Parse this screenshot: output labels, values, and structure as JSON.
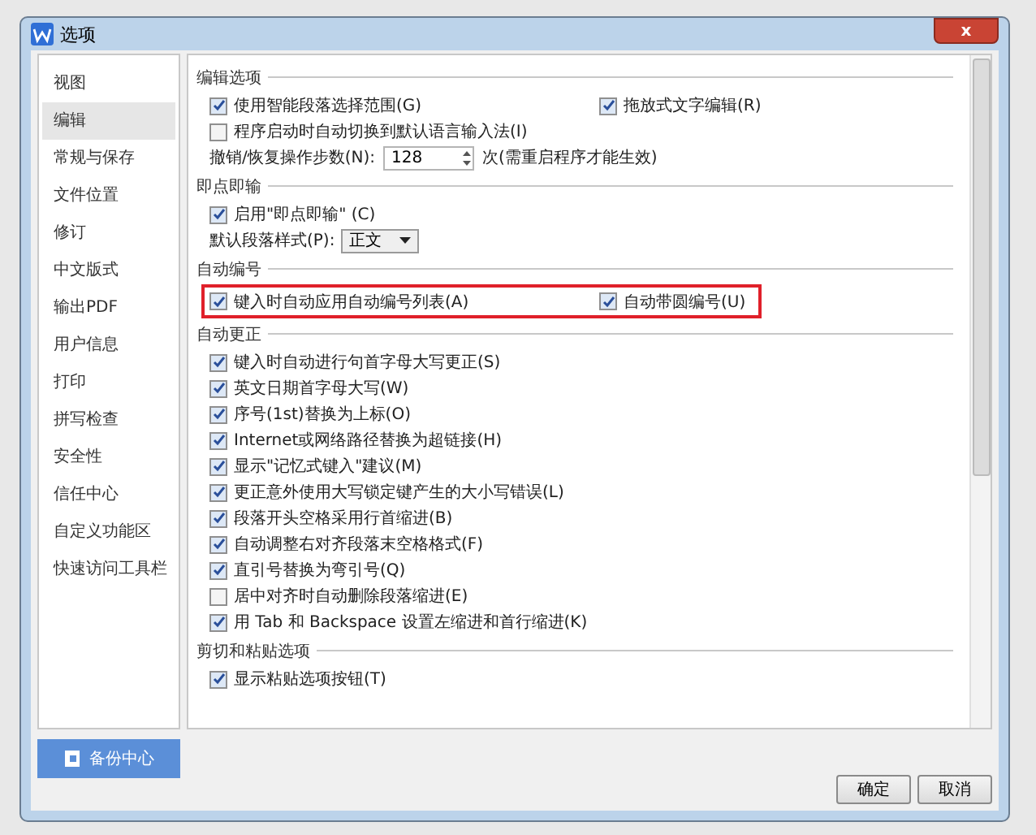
{
  "window": {
    "title": "选项",
    "close": "x"
  },
  "sidebar": {
    "items": [
      {
        "label": "视图",
        "selected": false
      },
      {
        "label": "编辑",
        "selected": true
      },
      {
        "label": "常规与保存",
        "selected": false
      },
      {
        "label": "文件位置",
        "selected": false
      },
      {
        "label": "修订",
        "selected": false
      },
      {
        "label": "中文版式",
        "selected": false
      },
      {
        "label": "输出PDF",
        "selected": false
      },
      {
        "label": "用户信息",
        "selected": false
      },
      {
        "label": "打印",
        "selected": false
      },
      {
        "label": "拼写检查",
        "selected": false
      },
      {
        "label": "安全性",
        "selected": false
      },
      {
        "label": "信任中心",
        "selected": false
      },
      {
        "label": "自定义功能区",
        "selected": false
      },
      {
        "label": "快速访问工具栏",
        "selected": false
      }
    ]
  },
  "backup_button": "备份中心",
  "sections": [
    {
      "title": "编辑选项",
      "highlighted": false,
      "rows": [
        {
          "kind": "pair",
          "items": [
            {
              "label": "使用智能段落选择范围(G)",
              "checked": true
            },
            {
              "label": "拖放式文字编辑(R)",
              "checked": true
            }
          ]
        },
        {
          "kind": "checkbox",
          "label": "程序启动时自动切换到默认语言输入法(I)",
          "checked": false
        },
        {
          "kind": "spinner",
          "label": "撤销/恢复操作步数(N):",
          "value": "128",
          "note": "次(需重启程序才能生效)"
        }
      ]
    },
    {
      "title": "即点即输",
      "highlighted": false,
      "rows": [
        {
          "kind": "checkbox",
          "label": "启用\"即点即输\" (C)",
          "checked": true
        },
        {
          "kind": "select",
          "label": "默认段落样式(P):",
          "value": "正文"
        }
      ]
    },
    {
      "title": "自动编号",
      "highlighted": true,
      "rows": [
        {
          "kind": "pair",
          "items": [
            {
              "label": "键入时自动应用自动编号列表(A)",
              "checked": true
            },
            {
              "label": "自动带圆编号(U)",
              "checked": true
            }
          ]
        }
      ]
    },
    {
      "title": "自动更正",
      "highlighted": false,
      "rows": [
        {
          "kind": "checkbox",
          "label": "键入时自动进行句首字母大写更正(S)",
          "checked": true
        },
        {
          "kind": "checkbox",
          "label": "英文日期首字母大写(W)",
          "checked": true
        },
        {
          "kind": "checkbox",
          "label": "序号(1st)替换为上标(O)",
          "checked": true
        },
        {
          "kind": "checkbox",
          "label": "Internet或网络路径替换为超链接(H)",
          "checked": true
        },
        {
          "kind": "checkbox",
          "label": "显示\"记忆式键入\"建议(M)",
          "checked": true
        },
        {
          "kind": "checkbox",
          "label": "更正意外使用大写锁定键产生的大小写错误(L)",
          "checked": true
        },
        {
          "kind": "checkbox",
          "label": "段落开头空格采用行首缩进(B)",
          "checked": true
        },
        {
          "kind": "checkbox",
          "label": "自动调整右对齐段落末空格格式(F)",
          "checked": true
        },
        {
          "kind": "checkbox",
          "label": "直引号替换为弯引号(Q)",
          "checked": true
        },
        {
          "kind": "checkbox",
          "label": "居中对齐时自动删除段落缩进(E)",
          "checked": false
        },
        {
          "kind": "checkbox",
          "label": "用 Tab 和 Backspace 设置左缩进和首行缩进(K)",
          "checked": true
        }
      ]
    },
    {
      "title": "剪切和粘贴选项",
      "highlighted": false,
      "rows": [
        {
          "kind": "checkbox",
          "label": "显示粘贴选项按钮(T)",
          "checked": true
        }
      ]
    }
  ],
  "buttons": [
    "确定",
    "取消"
  ]
}
